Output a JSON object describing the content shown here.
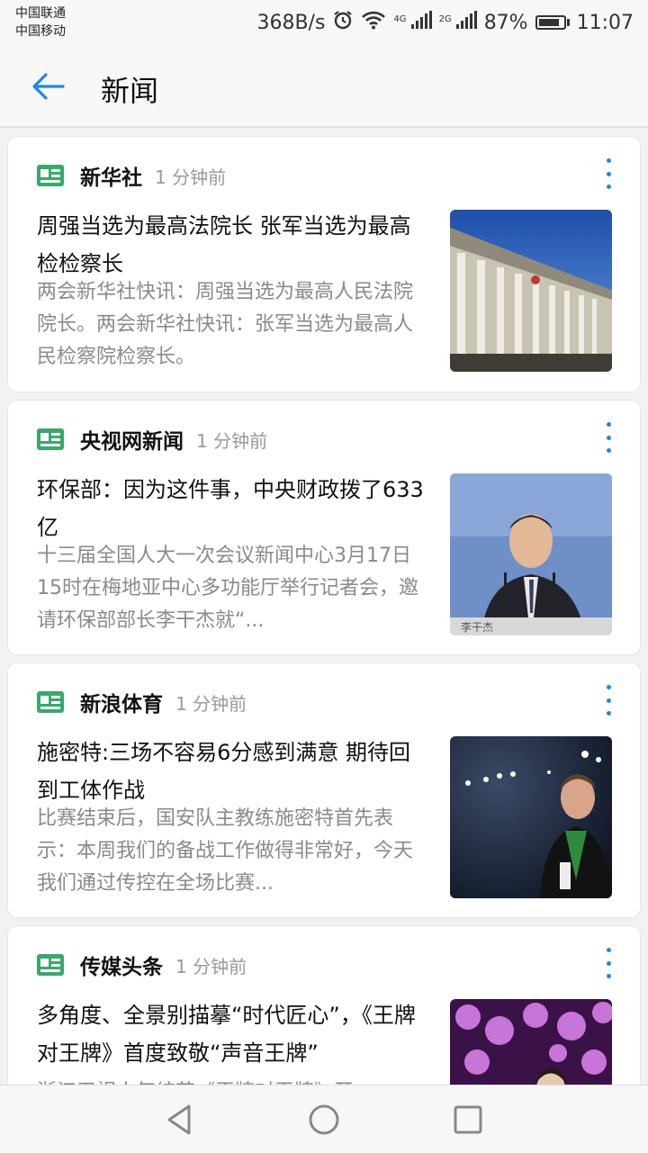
{
  "status_bar": {
    "carrier1": "中国联通",
    "carrier2": "中国移动",
    "net_speed": "368B/s",
    "net1": "4G",
    "net2": "2G",
    "battery": "87%",
    "battery_level": 0.87,
    "time": "11:07",
    "icons": [
      "alarm-icon",
      "wifi-icon",
      "signal-icon",
      "battery-icon"
    ]
  },
  "app_bar": {
    "title": "新闻",
    "back_icon": "back-arrow-icon",
    "accent_color": "#1e88e5"
  },
  "cards": [
    {
      "source": "新华社",
      "time": "1 分钟前",
      "headline": "周强当选为最高法院长 张军当选为最高检检察长",
      "summary": "两会新华社快讯：周强当选为最高人民法院院长。两会新华社快讯：张军当选为最高人民检察院检察长。"
    },
    {
      "source": "央视网新闻",
      "time": "1 分钟前",
      "headline": "环保部：因为这件事，中央财政拨了633亿",
      "summary": "十三届全国人大一次会议新闻中心3月17日15时在梅地亚中心多功能厅举行记者会，邀请环保部部长李干杰就“...",
      "image_caption": "李干杰"
    },
    {
      "source": "新浪体育",
      "time": "1 分钟前",
      "headline": "施密特:三场不容易6分感到满意 期待回到工体作战",
      "summary": "比赛结束后，国安队主教练施密特首先表示：本周我们的备战工作做得非常好，今天我们通过传控在全场比赛..."
    },
    {
      "source": "传媒头条",
      "time": "1 分钟前",
      "headline": "多角度、全景别描摹“时代匠心”，《王牌对王牌》首度致敬“声音王牌”",
      "summary": "浙江卫视人气综艺《王牌对王牌》开"
    }
  ],
  "nav_bar": {
    "buttons": [
      "back-triangle-icon",
      "home-circle-icon",
      "recents-square-icon"
    ]
  }
}
